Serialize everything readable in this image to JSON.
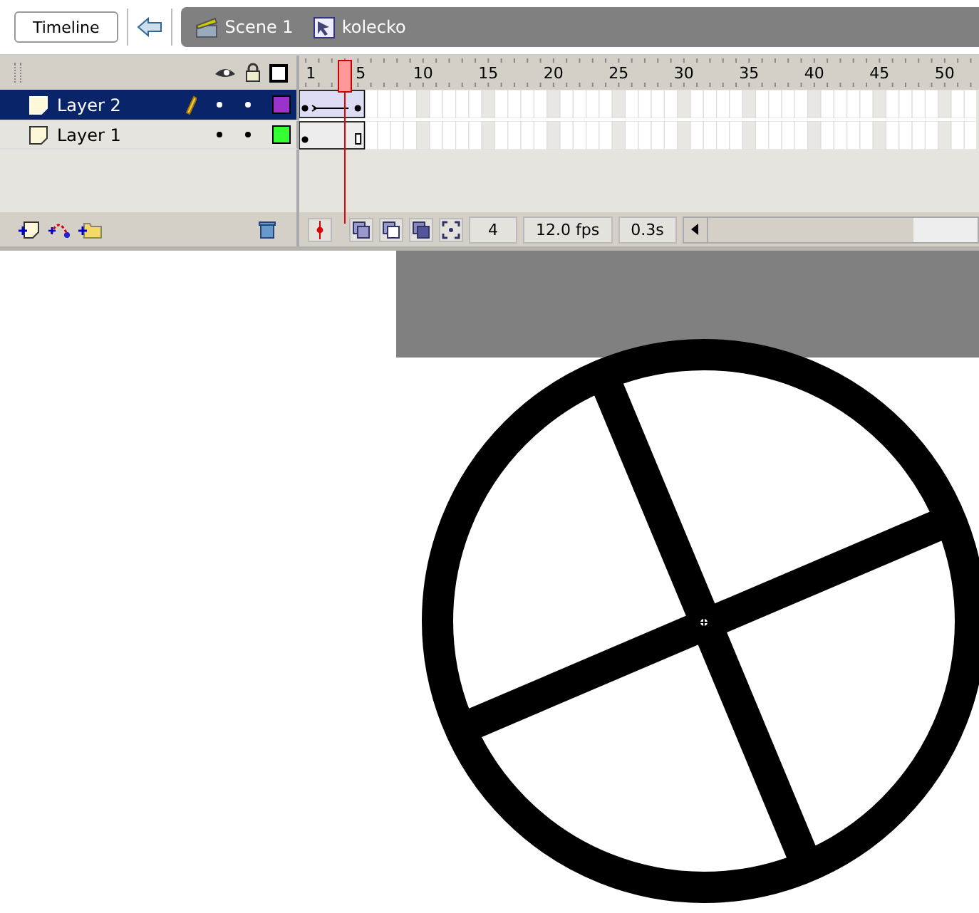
{
  "timeline_tab": {
    "label": "Timeline"
  },
  "breadcrumb": [
    {
      "kind": "scene",
      "label": "Scene 1"
    },
    {
      "kind": "symbol",
      "label": "kolecko"
    }
  ],
  "ruler": [
    "1",
    "5",
    "10",
    "15",
    "20",
    "25",
    "30",
    "35",
    "40",
    "45",
    "50"
  ],
  "layers": [
    {
      "name": "Layer 2",
      "selected": true,
      "editing": true,
      "color": "#9933cc",
      "kind": "tween"
    },
    {
      "name": "Layer 1",
      "selected": false,
      "editing": false,
      "color": "#33ff33",
      "kind": "static"
    }
  ],
  "status": {
    "frame": "4",
    "fps": "12.0 fps",
    "time": "0.3s"
  }
}
